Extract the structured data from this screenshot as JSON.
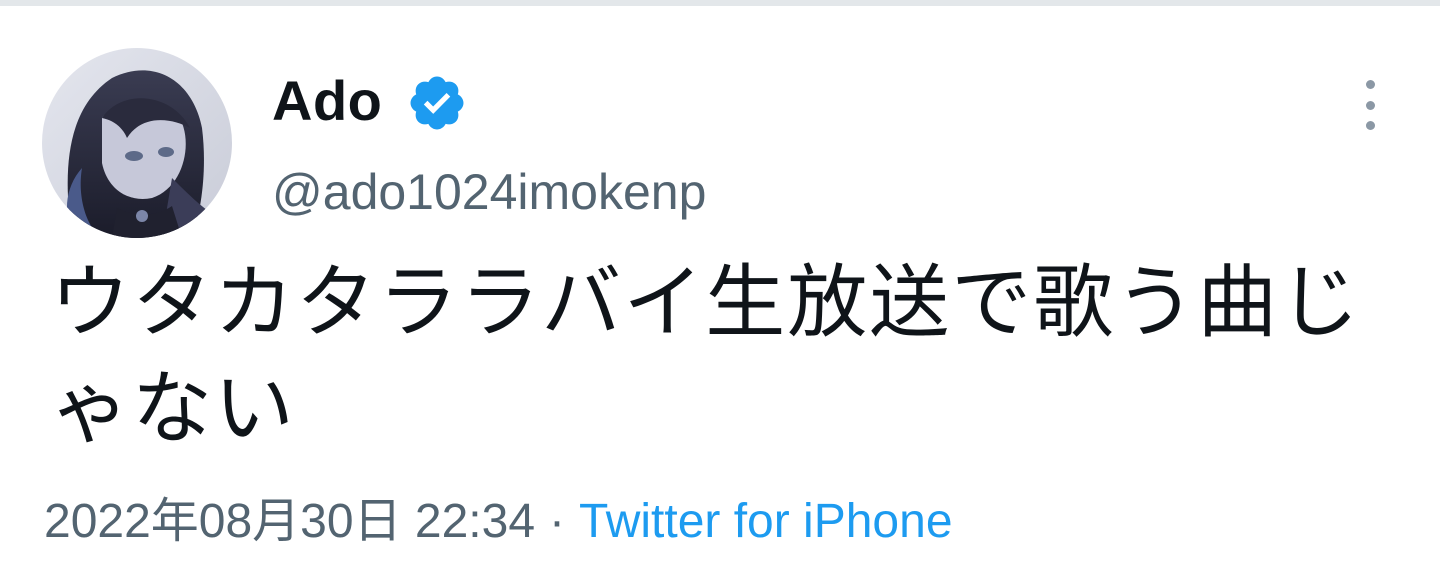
{
  "tweet": {
    "author": {
      "display_name": "Ado",
      "handle": "@ado1024imokenp",
      "verified": true,
      "avatar_icon": "avatar-illustration"
    },
    "text": "ウタカタララバイ生放送で歌う曲じゃない",
    "timestamp": "2022年08月30日 22:34",
    "separator": "·",
    "source": "Twitter for iPhone",
    "more_icon": "more-vertical-icon"
  },
  "colors": {
    "text_primary": "#0f1419",
    "text_secondary": "#536471",
    "link": "#1d9bf0",
    "verified": "#1d9bf0",
    "divider": "#e3e7ea"
  }
}
